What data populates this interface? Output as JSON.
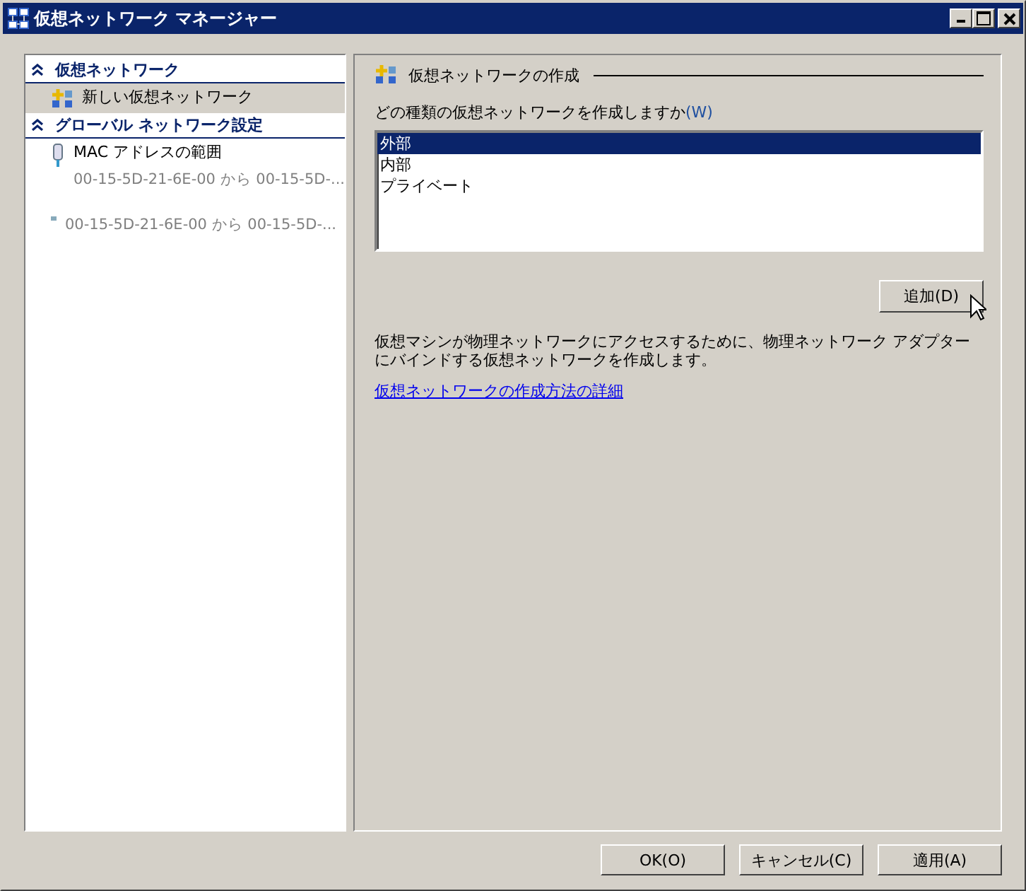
{
  "window": {
    "title": "仮想ネットワーク マネージャー"
  },
  "sidebar": {
    "sections": [
      {
        "title": "仮想ネットワーク",
        "expanded": true,
        "items": [
          {
            "kind": "network",
            "label": "新しい仮想ネットワーク",
            "selected": true
          }
        ]
      },
      {
        "title": "グローバル ネットワーク設定",
        "expanded": true,
        "items": [
          {
            "kind": "mac",
            "label": "MAC アドレスの範囲",
            "detail": "00-15-5D-21-6E-00 から 00-15-5D-...",
            "selected": false
          },
          {
            "kind": "mac-small",
            "detail": "00-15-5D-21-6E-00 から 00-15-5D-...",
            "selected": false
          }
        ]
      }
    ]
  },
  "panel": {
    "title": "仮想ネットワークの作成",
    "prompt": "どの種類の仮想ネットワークを作成しますか",
    "access_key": "(W)",
    "options": [
      {
        "label": "外部",
        "selected": true
      },
      {
        "label": "内部",
        "selected": false
      },
      {
        "label": "プライベート",
        "selected": false
      }
    ],
    "add_button": "追加(D)",
    "description": "仮想マシンが物理ネットワークにアクセスするために、物理ネットワーク アダプターにバインドする仮想ネットワークを作成します。",
    "link": "仮想ネットワークの作成方法の詳細"
  },
  "buttons": [
    "OK(O)",
    "キャンセル(C)",
    "適用(A)"
  ]
}
